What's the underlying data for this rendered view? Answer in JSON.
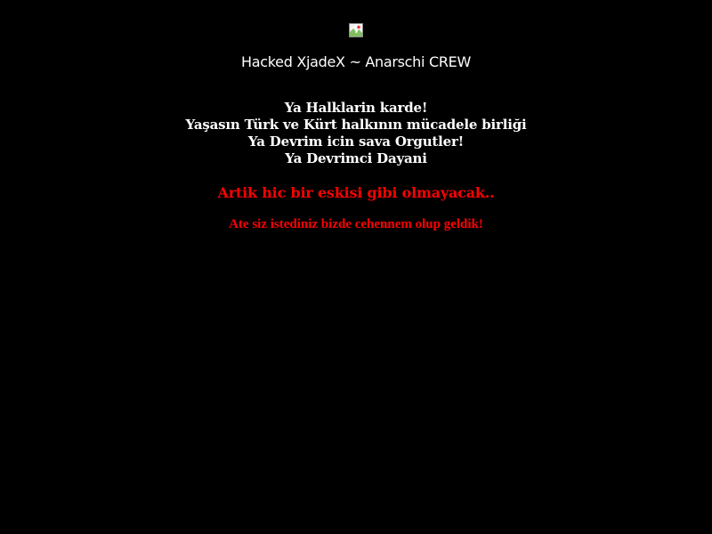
{
  "header": {
    "image": {
      "icon": "broken-image-icon"
    },
    "title": "Hacked XjadeX ~ Anarschi CREW"
  },
  "message": {
    "lines": [
      "Ya Halklarin karde!",
      "Yaşasın Türk ve Kürt halkının mücadele birliği",
      "Ya Devrim icin sava Orgutler!",
      "Ya Devrimci Dayani"
    ],
    "warning": "Artik hic bir eskisi gibi olmayacak..",
    "closing": "Ate siz istediniz bizde cehennem olup geldik!"
  },
  "colors": {
    "background": "#000000",
    "text": "#ffffff",
    "alert": "#ff0000"
  }
}
